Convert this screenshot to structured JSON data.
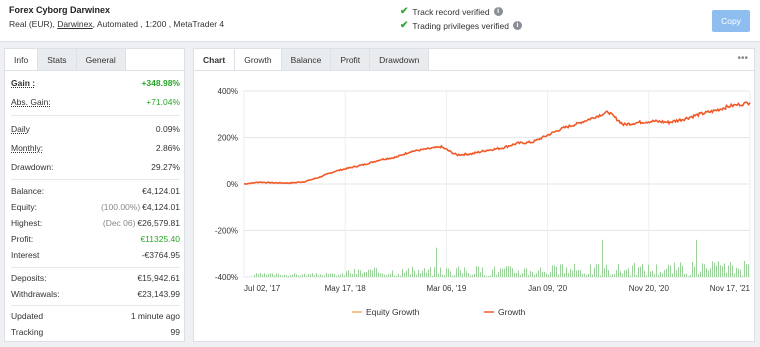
{
  "header": {
    "title": "Forex Cyborg Darwinex",
    "sub_prefix": "Real (EUR),",
    "broker": "Darwinex",
    "sub_suffix": ", Automated , 1:200 , MetaTrader 4",
    "verified_1": "Track record verified",
    "verified_2": "Trading privileges verified",
    "copy_label": "Copy"
  },
  "left_tabs": [
    "Info",
    "Stats",
    "General"
  ],
  "stats": {
    "gain": {
      "label": "Gain :",
      "value": "+348.98%"
    },
    "abs_gain": {
      "label": "Abs. Gain:",
      "value": "+71.04%"
    },
    "daily": {
      "label": "Daily",
      "value": "0.09%"
    },
    "monthly": {
      "label": "Monthly:",
      "value": "2.86%"
    },
    "drawdown": {
      "label": "Drawdown:",
      "value": "29.27%"
    },
    "balance": {
      "label": "Balance:",
      "value": "€4,124.01"
    },
    "equity": {
      "label": "Equity:",
      "note": "(100.00%)",
      "value": "€4,124.01"
    },
    "highest": {
      "label": "Highest:",
      "note": "(Dec 06)",
      "value": "€26,579.81"
    },
    "profit": {
      "label": "Profit:",
      "value": "€11325.40"
    },
    "interest": {
      "label": "Interest",
      "value": "-€3764.95"
    },
    "deposits": {
      "label": "Deposits:",
      "value": "€15,942.61"
    },
    "withdrawals": {
      "label": "Withdrawals:",
      "value": "€23,143.99"
    },
    "updated": {
      "label": "Updated",
      "value": "1 minute ago"
    },
    "tracking": {
      "label": "Tracking",
      "value": "99"
    }
  },
  "chart_tabs": [
    "Chart",
    "Growth",
    "Balance",
    "Profit",
    "Drawdown"
  ],
  "colors": {
    "growth": "#f05a28",
    "equity": "#f0b060",
    "volume": "#9ad39a",
    "green": "#2aa52a"
  },
  "chart_data": {
    "type": "line",
    "yticks": [
      "400%",
      "200%",
      "0%",
      "-200%",
      "-400%"
    ],
    "ylim": [
      -400,
      400
    ],
    "xticks": [
      "Jul 02, '17",
      "May 17, '18",
      "Mar 06, '19",
      "Jan 09, '20",
      "Nov 20, '20",
      "Nov 17, '21"
    ],
    "legend": [
      "Equity Growth",
      "Growth"
    ],
    "series": [
      {
        "name": "Growth",
        "points": [
          [
            0,
            0
          ],
          [
            0.03,
            8
          ],
          [
            0.06,
            5
          ],
          [
            0.09,
            4
          ],
          [
            0.12,
            10
          ],
          [
            0.15,
            30
          ],
          [
            0.18,
            55
          ],
          [
            0.21,
            70
          ],
          [
            0.24,
            85
          ],
          [
            0.27,
            105
          ],
          [
            0.3,
            115
          ],
          [
            0.33,
            140
          ],
          [
            0.36,
            150
          ],
          [
            0.39,
            160
          ],
          [
            0.42,
            125
          ],
          [
            0.45,
            130
          ],
          [
            0.48,
            145
          ],
          [
            0.51,
            155
          ],
          [
            0.54,
            175
          ],
          [
            0.57,
            180
          ],
          [
            0.6,
            210
          ],
          [
            0.63,
            240
          ],
          [
            0.66,
            260
          ],
          [
            0.69,
            285
          ],
          [
            0.72,
            310
          ],
          [
            0.75,
            255
          ],
          [
            0.78,
            265
          ],
          [
            0.81,
            270
          ],
          [
            0.84,
            265
          ],
          [
            0.87,
            280
          ],
          [
            0.9,
            300
          ],
          [
            0.93,
            315
          ],
          [
            0.96,
            335
          ],
          [
            1.0,
            350
          ]
        ]
      }
    ]
  }
}
